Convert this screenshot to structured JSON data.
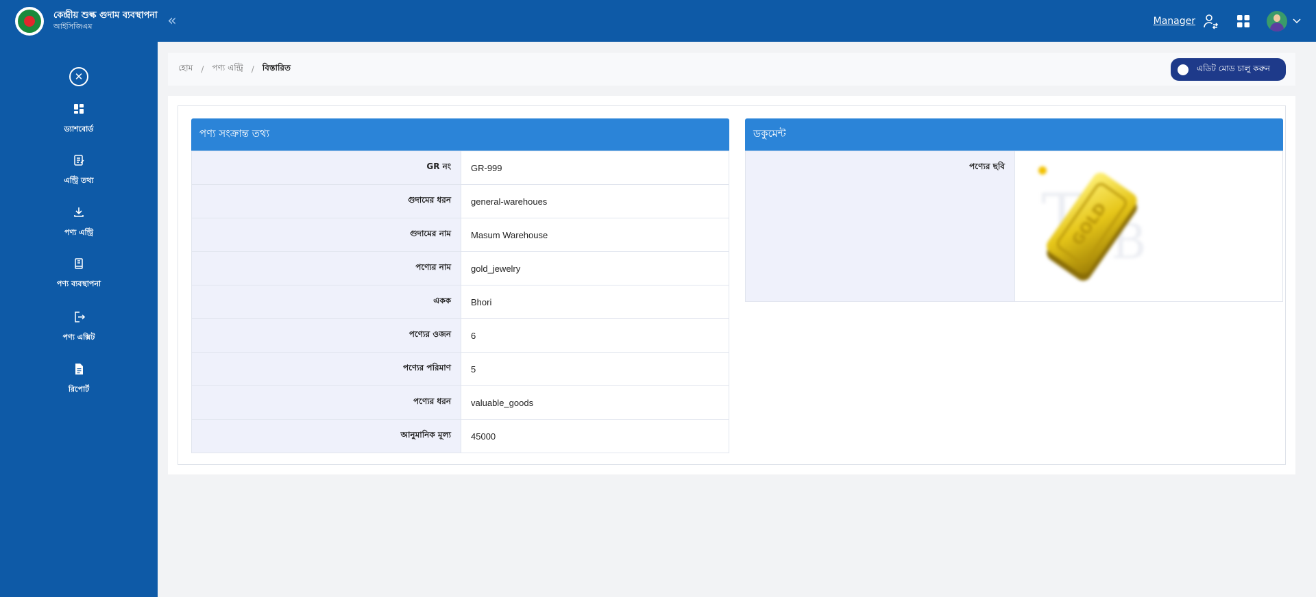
{
  "header": {
    "app_title": "কেন্দ্রীয় শুল্ক গুদাম ব্যবস্থাপনা",
    "app_subtitle": "আইসিজিএম",
    "collapse_symbol": "«",
    "role_label": "Manager",
    "icons": [
      "emblem-logo",
      "user-switch-icon",
      "apps-grid-icon",
      "avatar",
      "chevron-down-icon"
    ],
    "brand_colors": {
      "primary": "#0e5aa7",
      "emblem_green": "#1a8a3c",
      "emblem_red": "#e3262d"
    }
  },
  "sidebar": {
    "close_symbol": "✕",
    "items": [
      {
        "label": "ড্যাশবোর্ড",
        "icon": "dashboard-icon"
      },
      {
        "label": "এন্ট্রি তথ্য",
        "icon": "entry-info-icon"
      },
      {
        "label": "পণ্য এন্ট্রি",
        "icon": "download-icon"
      },
      {
        "label": "পণ্য ব্যবস্থাপনা",
        "icon": "book-icon"
      },
      {
        "label": "পণ্য এক্সিট",
        "icon": "exit-icon"
      },
      {
        "label": "রিপোর্ট",
        "icon": "report-icon"
      }
    ]
  },
  "breadcrumb": {
    "items": [
      "হোম",
      "পণ্য এন্ট্রি",
      "বিস্তারিত"
    ],
    "separator": "/"
  },
  "edit_mode": {
    "label": "এডিট মোড চালু করুন",
    "enabled": false
  },
  "product_info": {
    "title": "পণ্য সংক্রান্ত তথ্য",
    "rows": [
      {
        "label": "GR নং",
        "value": "GR-999"
      },
      {
        "label": "গুদামের ধরন",
        "value": "general-warehoues"
      },
      {
        "label": "গুদামের নাম",
        "value": "Masum Warehouse"
      },
      {
        "label": "পণ্যের নাম",
        "value": "gold_jewelry"
      },
      {
        "label": "একক",
        "value": "Bhori"
      },
      {
        "label": "পণ্যের ওজন",
        "value": "6"
      },
      {
        "label": "পণ্যের পরিমাণ",
        "value": "5"
      },
      {
        "label": "পণ্যের ধরন",
        "value": "valuable_goods"
      },
      {
        "label": "আনুমানিক মূল্য",
        "value": "45000"
      }
    ]
  },
  "documents": {
    "title": "ডকুমেন্ট",
    "image_label": "পণ্যের ছবি",
    "image_icon": "gold-bar-image"
  }
}
